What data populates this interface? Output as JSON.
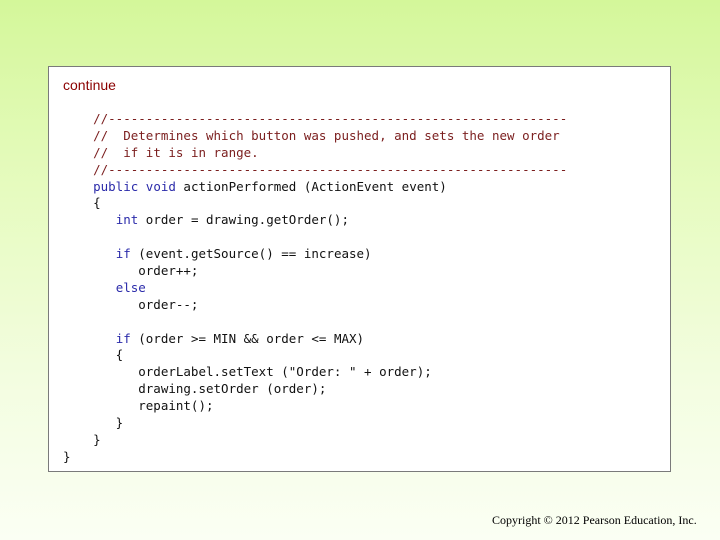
{
  "slide": {
    "continue_label": "continue",
    "copyright": "Copyright © 2012 Pearson Education, Inc."
  },
  "code_lines": [
    [
      {
        "t": "    ",
        "s": "n"
      },
      {
        "t": "//-------------------------------------------------------------",
        "s": "c"
      }
    ],
    [
      {
        "t": "    ",
        "s": "n"
      },
      {
        "t": "//  Determines which button was pushed, and sets the new order",
        "s": "c"
      }
    ],
    [
      {
        "t": "    ",
        "s": "n"
      },
      {
        "t": "//  if it is in range.",
        "s": "c"
      }
    ],
    [
      {
        "t": "    ",
        "s": "n"
      },
      {
        "t": "//-------------------------------------------------------------",
        "s": "c"
      }
    ],
    [
      {
        "t": "    ",
        "s": "n"
      },
      {
        "t": "public void",
        "s": "k"
      },
      {
        "t": " actionPerformed (ActionEvent event)",
        "s": "n"
      }
    ],
    [
      {
        "t": "    {",
        "s": "n"
      }
    ],
    [
      {
        "t": "       ",
        "s": "n"
      },
      {
        "t": "int",
        "s": "k"
      },
      {
        "t": " order = drawing.getOrder();",
        "s": "n"
      }
    ],
    [
      {
        "t": "",
        "s": "n"
      }
    ],
    [
      {
        "t": "       ",
        "s": "n"
      },
      {
        "t": "if",
        "s": "k"
      },
      {
        "t": " (event.getSource() == increase)",
        "s": "n"
      }
    ],
    [
      {
        "t": "          order++;",
        "s": "n"
      }
    ],
    [
      {
        "t": "       ",
        "s": "n"
      },
      {
        "t": "else",
        "s": "k"
      }
    ],
    [
      {
        "t": "          order--;",
        "s": "n"
      }
    ],
    [
      {
        "t": "",
        "s": "n"
      }
    ],
    [
      {
        "t": "       ",
        "s": "n"
      },
      {
        "t": "if",
        "s": "k"
      },
      {
        "t": " (order >= MIN && order <= MAX)",
        "s": "n"
      }
    ],
    [
      {
        "t": "       {",
        "s": "n"
      }
    ],
    [
      {
        "t": "          orderLabel.setText (\"Order: \" + order);",
        "s": "n"
      }
    ],
    [
      {
        "t": "          drawing.setOrder (order);",
        "s": "n"
      }
    ],
    [
      {
        "t": "          repaint();",
        "s": "n"
      }
    ],
    [
      {
        "t": "       }",
        "s": "n"
      }
    ],
    [
      {
        "t": "    }",
        "s": "n"
      }
    ],
    [
      {
        "t": "}",
        "s": "n"
      }
    ]
  ]
}
